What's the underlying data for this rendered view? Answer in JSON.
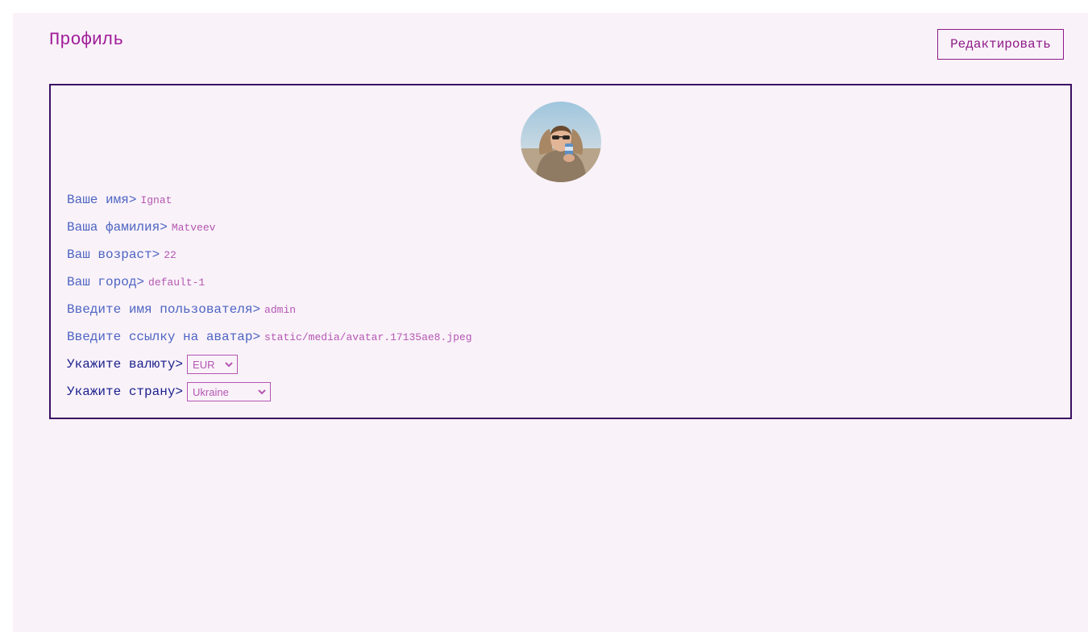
{
  "header": {
    "title": "Профиль",
    "edit_label": "Редактировать"
  },
  "profile": {
    "avatar_icon": "avatar-photo",
    "fields": [
      {
        "label": "Ваше имя>",
        "value": "Ignat"
      },
      {
        "label": "Ваша фамилия>",
        "value": "Matveev"
      },
      {
        "label": "Ваш возраст>",
        "value": "22"
      },
      {
        "label": "Ваш город>",
        "value": "default-1"
      },
      {
        "label": "Введите имя пользователя>",
        "value": "admin"
      },
      {
        "label": "Введите ссылку на аватар>",
        "value": "static/media/avatar.17135ae8.jpeg"
      }
    ],
    "currency": {
      "label": "Укажите валюту>",
      "selected": "EUR"
    },
    "country": {
      "label": "Укажите страну>",
      "selected": "Ukraine"
    }
  },
  "colors": {
    "background": "#f9f2f9",
    "title": "#a01e99",
    "card_border": "#3b0f63",
    "label": "#4d64c2",
    "value": "#b456b2"
  }
}
